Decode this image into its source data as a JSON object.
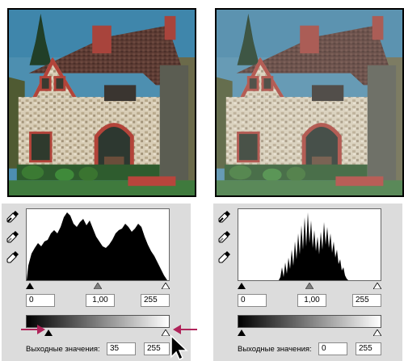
{
  "left_panel": {
    "input_black": "0",
    "input_gamma": "1,00",
    "input_white": "255",
    "output_label": "Выходные значения:",
    "output_black": "35",
    "output_white": "255",
    "output_black_level": 0.137,
    "output_white_level": 1.0
  },
  "right_panel": {
    "input_black": "0",
    "input_gamma": "1,00",
    "input_white": "255",
    "output_label": "Выходные значения:",
    "output_black": "0",
    "output_white": "255",
    "output_black_level": 0.0,
    "output_white_level": 1.0
  },
  "icons": [
    "eyedropper-black-icon",
    "eyedropper-gray-icon",
    "eyedropper-white-icon",
    "arrow-right-icon",
    "arrow-left-icon",
    "cursor-arrow-icon"
  ],
  "colors": {
    "annotation_arrow": "#b0245a",
    "panel_bg": "#dcdcdc"
  }
}
